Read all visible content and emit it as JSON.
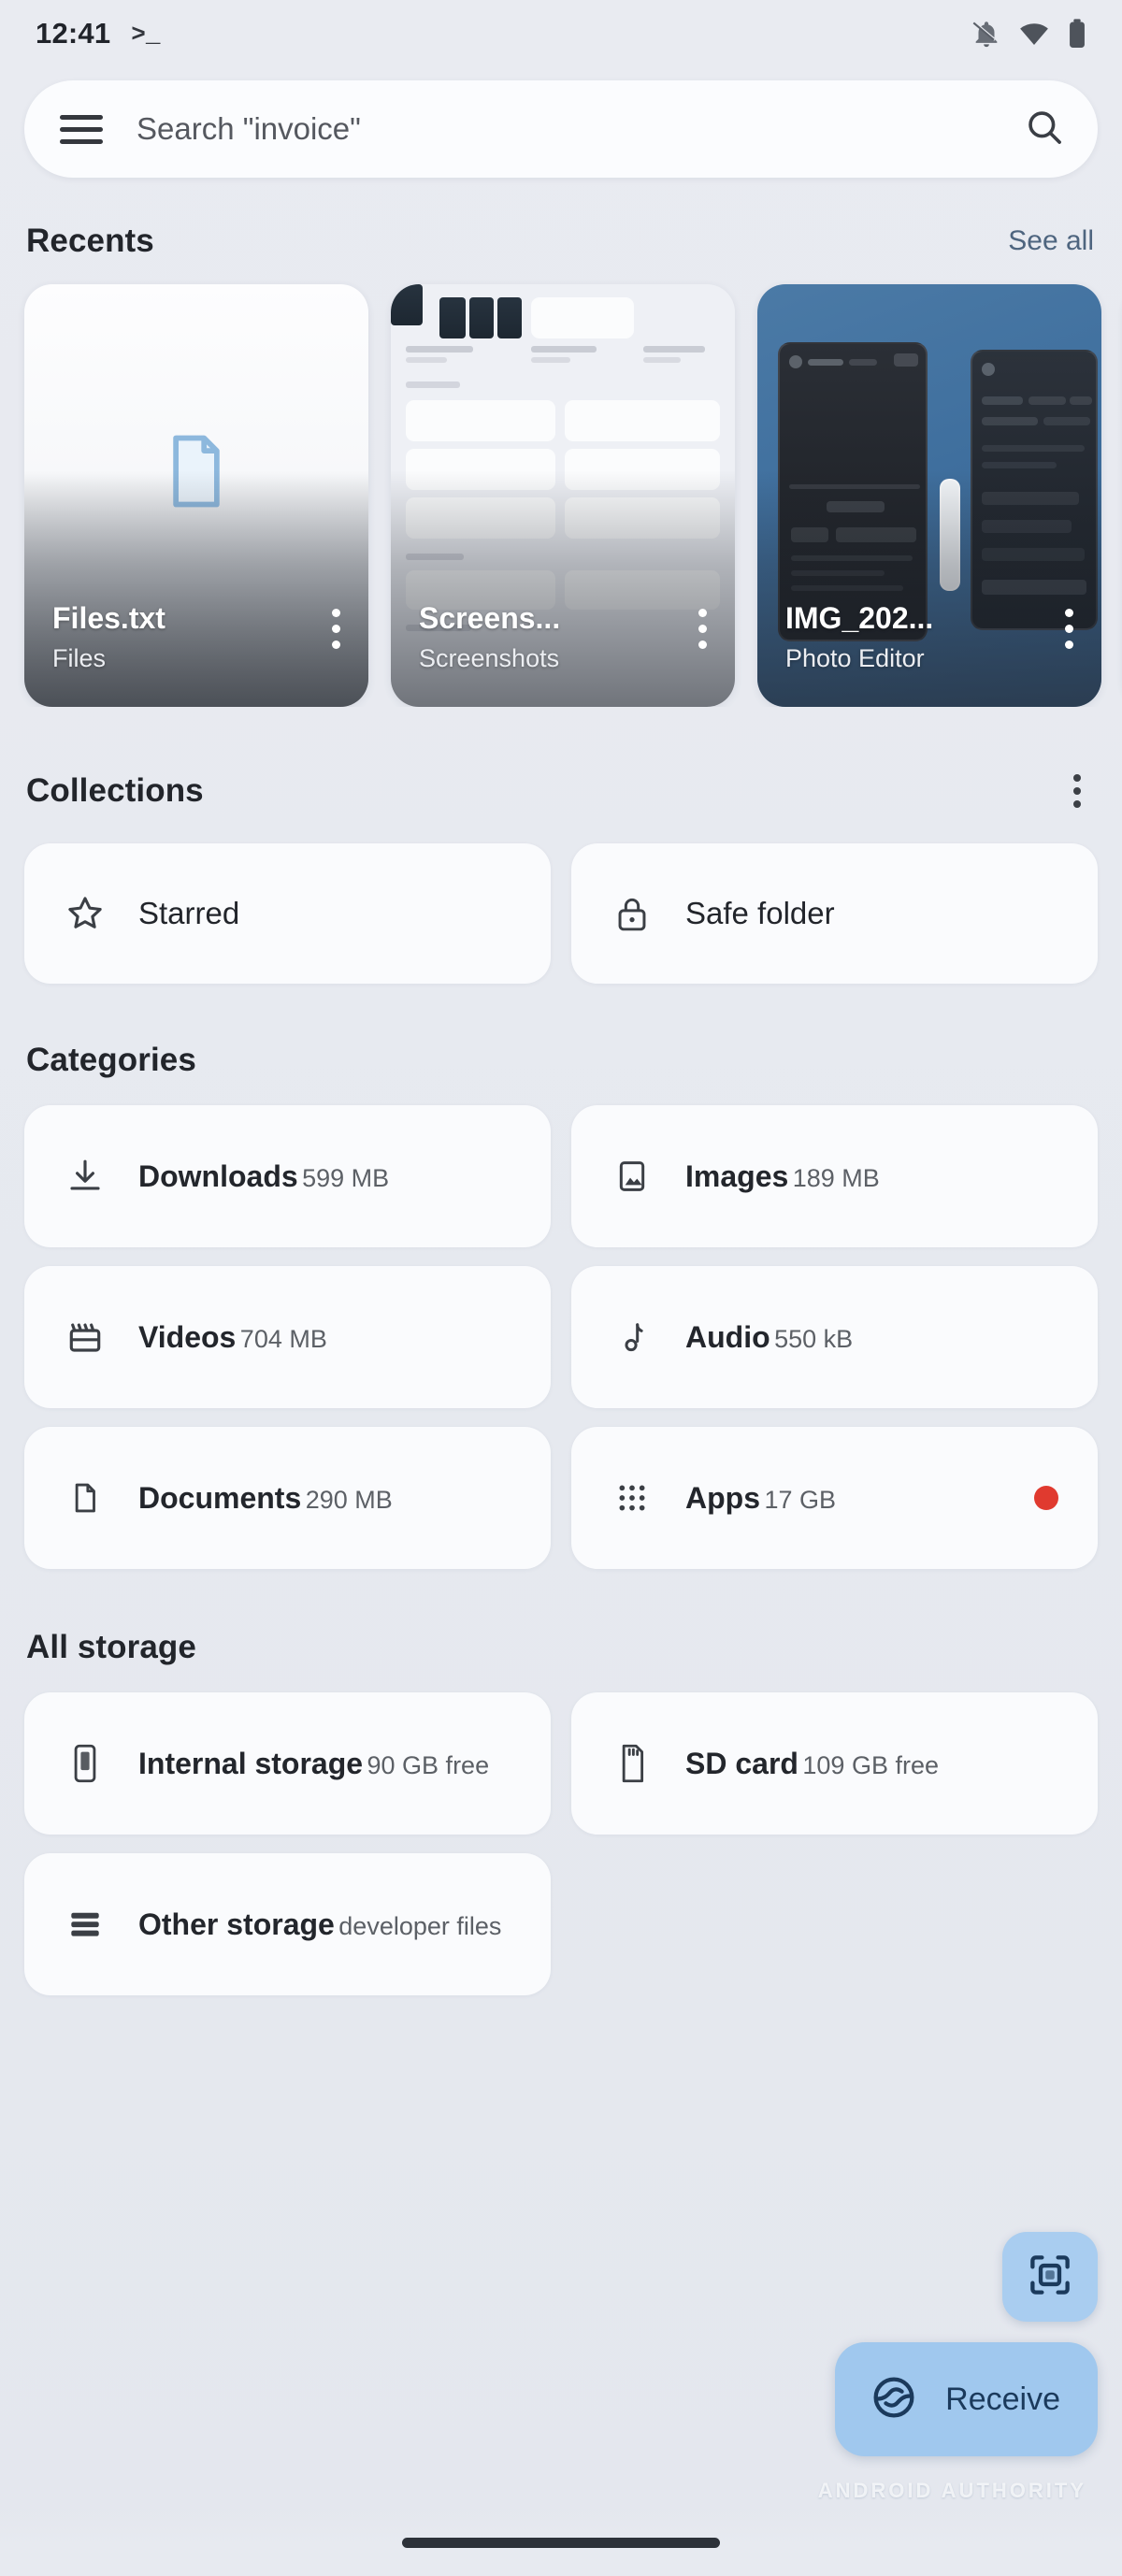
{
  "status_bar": {
    "time": "12:41",
    "shell_glyph": ">_",
    "icons": [
      "mute-icon",
      "wifi-icon",
      "battery-icon"
    ]
  },
  "search": {
    "menu_icon": "hamburger-menu-icon",
    "placeholder": "Search \"invoice\"",
    "value": "",
    "search_icon": "search-icon"
  },
  "recents": {
    "title": "Recents",
    "see_all": "See all",
    "cards": [
      {
        "name": "Files.txt",
        "source": "Files",
        "thumb": "document-icon"
      },
      {
        "name": "Screens...",
        "source": "Screenshots",
        "thumb": "app-screenshot"
      },
      {
        "name": "IMG_202...",
        "source": "Photo Editor",
        "thumb": "photo-editor-screenshot"
      },
      {
        "name": "",
        "source": "",
        "thumb": "partial-card"
      }
    ]
  },
  "collections": {
    "title": "Collections",
    "menu_icon": "overflow-menu-icon",
    "items": [
      {
        "label": "Starred",
        "icon": "star-icon"
      },
      {
        "label": "Safe folder",
        "icon": "lock-icon"
      }
    ]
  },
  "categories": {
    "title": "Categories",
    "items": [
      {
        "label": "Downloads",
        "size": "599 MB",
        "icon": "download-icon",
        "badge": false
      },
      {
        "label": "Images",
        "size": "189 MB",
        "icon": "image-icon",
        "badge": false
      },
      {
        "label": "Videos",
        "size": "704 MB",
        "icon": "video-icon",
        "badge": false
      },
      {
        "label": "Audio",
        "size": "550 kB",
        "icon": "music-note-icon",
        "badge": false
      },
      {
        "label": "Documents",
        "size": "290 MB",
        "icon": "document-icon",
        "badge": false
      },
      {
        "label": "Apps",
        "size": "17 GB",
        "icon": "apps-grid-icon",
        "badge": true
      }
    ]
  },
  "all_storage": {
    "title": "All storage",
    "items": [
      {
        "label": "Internal storage",
        "size": "90 GB free",
        "icon": "phone-icon"
      },
      {
        "label": "SD card",
        "size": "109 GB free",
        "icon": "sd-card-icon"
      },
      {
        "label": "Other storage",
        "size": "developer files",
        "icon": "storage-list-icon"
      }
    ]
  },
  "fabs": {
    "scan": {
      "label": "",
      "icon": "qr-scan-icon"
    },
    "receive": {
      "label": "Receive",
      "icon": "nearby-share-icon"
    }
  },
  "watermark": "ANDROID AUTHORITY",
  "colors": {
    "background": "#e8eaf0",
    "card": "#fafbfd",
    "accent": "#a0c8ee",
    "accent_icon": "#1b3a5c",
    "badge": "#e03a2f",
    "text_primary": "#23262c",
    "text_secondary": "#5c6066",
    "link": "#4e657f"
  }
}
